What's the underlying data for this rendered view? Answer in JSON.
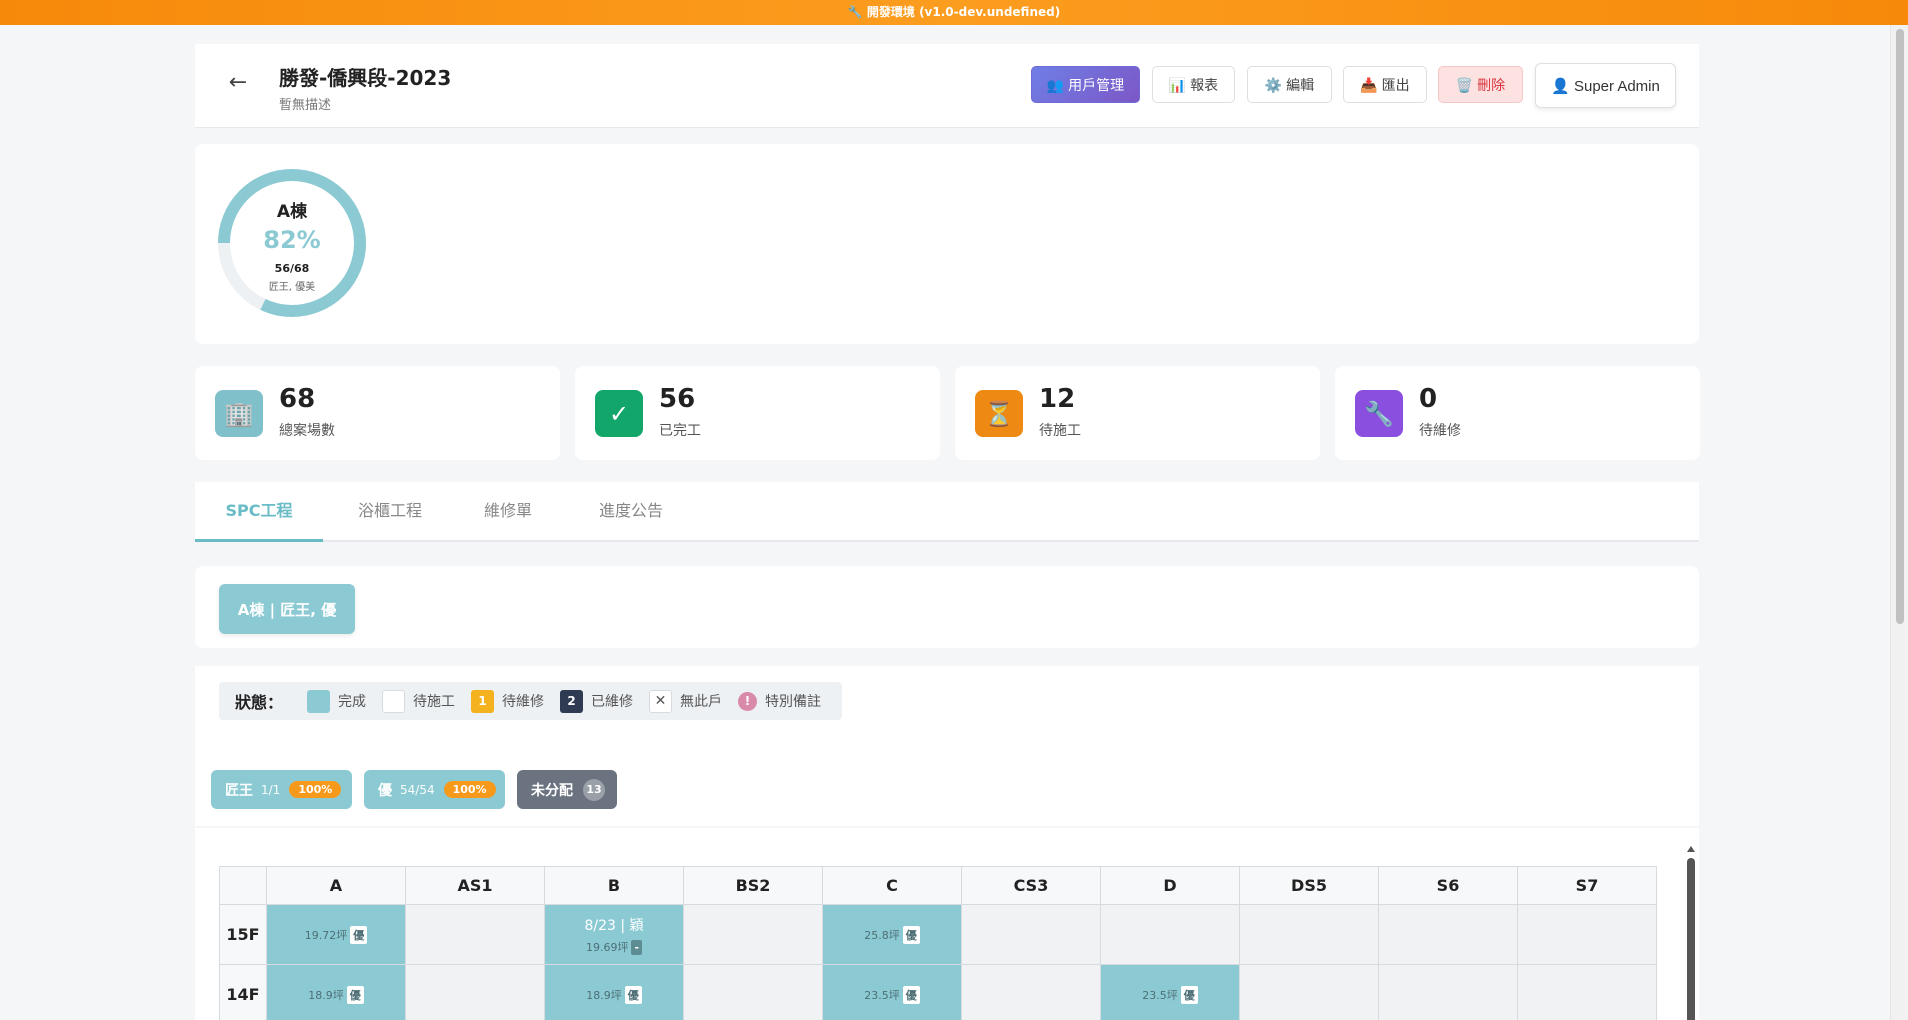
{
  "devbar": {
    "text": "🔧 開發環境 (v1.0-dev.undefined)"
  },
  "header": {
    "back_icon": "←",
    "title": "勝發-僑興段-2023",
    "description": "暫無描述",
    "buttons": {
      "users": "👥 用戶管理",
      "report": "📊 報表",
      "edit": "⚙️ 編輯",
      "export": "📥 匯出",
      "delete": "🗑️ 刪除",
      "admin": "👤 Super Admin"
    }
  },
  "building": {
    "name": "A棟",
    "percent": "82%",
    "progress": 0.82,
    "count": "56/68",
    "teams": "匠王, 優美",
    "ring_color": "#8ccad3"
  },
  "stats": [
    {
      "icon": "🏢",
      "value": "68",
      "label": "總案場數",
      "color": "#7fc0ca"
    },
    {
      "icon": "✓",
      "value": "56",
      "label": "已完工",
      "color": "#12a66a"
    },
    {
      "icon": "⏳",
      "value": "12",
      "label": "待施工",
      "color": "#ee8a14"
    },
    {
      "icon": "🔧",
      "value": "0",
      "label": "待維修",
      "color": "#8b4fe0"
    }
  ],
  "tabs": [
    "SPC工程",
    "浴櫃工程",
    "維修單",
    "進度公告"
  ],
  "building_filter": {
    "label": "A棟 | 匠王, 優"
  },
  "legend": {
    "title": "狀態：",
    "items": {
      "done": "完成",
      "pending": "待施工",
      "repair_badge": "1",
      "repair": "待維修",
      "repaired_badge": "2",
      "repaired": "已維修",
      "none_badge": "✕",
      "none": "無此戶",
      "note_badge": "!",
      "note": "特別備註"
    }
  },
  "teams": [
    {
      "name": "匠王",
      "count": "1/1",
      "pct": "100%"
    },
    {
      "name": "優",
      "count": "54/54",
      "pct": "100%"
    },
    {
      "name": "未分配",
      "badge": "13"
    }
  ],
  "grid": {
    "columns": [
      "A",
      "AS1",
      "B",
      "BS2",
      "C",
      "CS3",
      "D",
      "DS5",
      "S6",
      "S7"
    ],
    "rows": [
      {
        "floor": "15F",
        "cells": [
          {
            "area": "19.72坪",
            "tag": "優"
          },
          null,
          {
            "line1": "8/23 | 穎",
            "area": "19.69坪",
            "tag": "-"
          },
          null,
          {
            "area": "25.8坪",
            "tag": "優"
          },
          null,
          null,
          null,
          null,
          null
        ]
      },
      {
        "floor": "14F",
        "cells": [
          {
            "area": "18.9坪",
            "tag": "優"
          },
          null,
          {
            "area": "18.9坪",
            "tag": "優"
          },
          null,
          {
            "area": "23.5坪",
            "tag": "優"
          },
          null,
          {
            "area": "23.5坪",
            "tag": "優"
          },
          null,
          null,
          null
        ]
      }
    ]
  }
}
